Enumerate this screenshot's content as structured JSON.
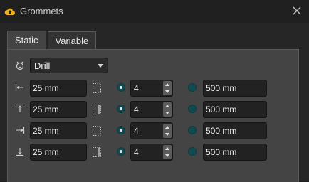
{
  "window": {
    "title": "Grommets",
    "close_icon": "close-icon"
  },
  "tabs": [
    {
      "label": "Static",
      "active": true
    },
    {
      "label": "Variable",
      "active": false
    }
  ],
  "type_select": {
    "icon": "grommet-icon",
    "value": "Drill"
  },
  "rows": [
    {
      "icon": "left-offset-icon",
      "length": "25 mm",
      "aux_icon": "pattern-icon",
      "count": "4",
      "value": "500 mm",
      "radio_count_selected": true
    },
    {
      "icon": "top-offset-icon",
      "length": "25 mm",
      "aux_icon": "pattern-dashed-icon",
      "count": "4",
      "value": "500 mm",
      "radio_count_selected": true
    },
    {
      "icon": "right-offset-icon",
      "length": "25 mm",
      "aux_icon": "pattern-icon",
      "count": "4",
      "value": "500 mm",
      "radio_count_selected": true
    },
    {
      "icon": "bottom-offset-icon",
      "length": "25 mm",
      "aux_icon": "pattern-dashed-icon",
      "count": "4",
      "value": "500 mm",
      "radio_count_selected": true
    }
  ],
  "colors": {
    "accent_radio": "#124a52",
    "app_icon": "#f2b21a"
  }
}
